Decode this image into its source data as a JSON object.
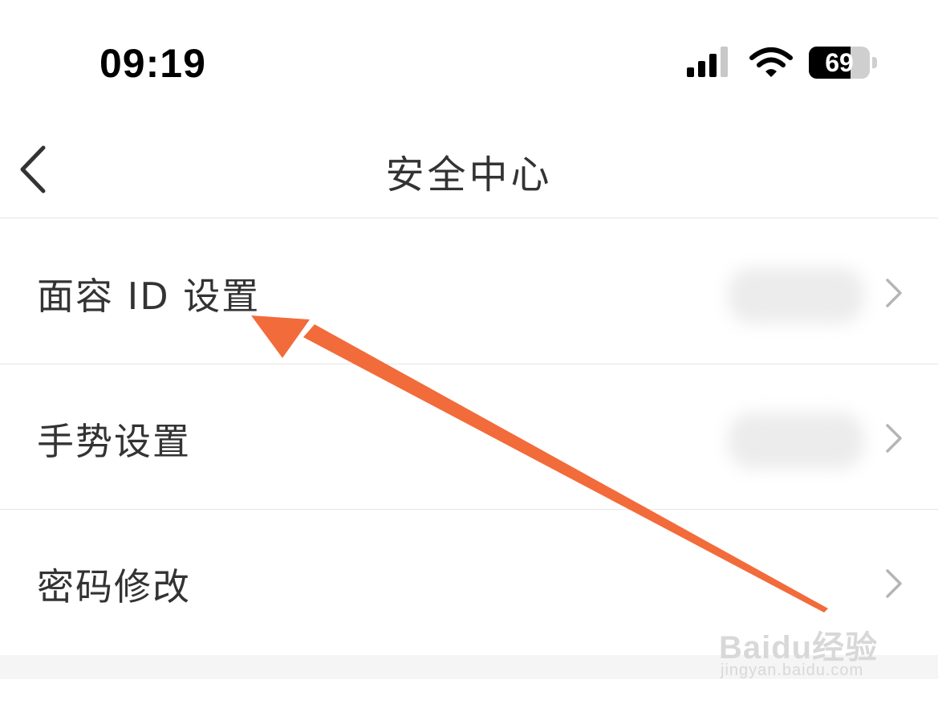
{
  "status_bar": {
    "time": "09:19",
    "battery_level": "69",
    "battery_fraction": 0.69
  },
  "nav": {
    "title": "安全中心",
    "back_icon": "chevron-left-icon"
  },
  "settings": {
    "items": [
      {
        "label": "面容 ID 设置",
        "icon": "chevron-right-icon"
      },
      {
        "label": "手势设置",
        "icon": "chevron-right-icon"
      },
      {
        "label": "密码修改",
        "icon": "chevron-right-icon"
      }
    ]
  },
  "annotation": {
    "color": "#f26b3a"
  },
  "watermark": {
    "brand": "Baidu经验",
    "url": "jingyan.baidu.com"
  }
}
